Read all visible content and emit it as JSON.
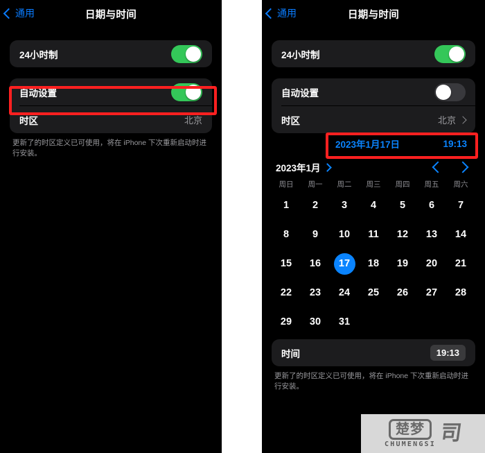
{
  "colors": {
    "background": "#000000",
    "card": "#1c1c1e",
    "accent_blue": "#0a84ff",
    "toggle_on_green": "#34c759",
    "toggle_off_gray": "#39393d",
    "annotation_red": "#ff2020",
    "secondary_text": "#8e8e93"
  },
  "left_panel": {
    "nav": {
      "back_label": "通用",
      "title": "日期与时间"
    },
    "rows": {
      "hour24_label": "24小时制",
      "hour24_state": "on",
      "auto_label": "自动设置",
      "auto_state": "on",
      "timezone_label": "时区",
      "timezone_value": "北京"
    },
    "footnote": "更新了的时区定义已可使用，将在 iPhone 下次重新启动时进行安装。"
  },
  "right_panel": {
    "nav": {
      "back_label": "通用",
      "title": "日期与时间"
    },
    "rows": {
      "hour24_label": "24小时制",
      "hour24_state": "on",
      "auto_label": "自动设置",
      "auto_state": "off",
      "timezone_label": "时区",
      "timezone_value": "北京"
    },
    "datetime_field": {
      "date_value": "2023年1月17日",
      "time_value": "19:13"
    },
    "calendar": {
      "month_label": "2023年1月",
      "prev_arrow": "chevron-left-icon",
      "next_arrow": "chevron-right-icon",
      "weekdays": [
        "周日",
        "周一",
        "周二",
        "周三",
        "周四",
        "周五",
        "周六"
      ],
      "weeks": [
        [
          "1",
          "2",
          "3",
          "4",
          "5",
          "6",
          "7"
        ],
        [
          "8",
          "9",
          "10",
          "11",
          "12",
          "13",
          "14"
        ],
        [
          "15",
          "16",
          "17",
          "18",
          "19",
          "20",
          "21"
        ],
        [
          "22",
          "23",
          "24",
          "25",
          "26",
          "27",
          "28"
        ],
        [
          "29",
          "30",
          "31",
          "",
          "",
          "",
          ""
        ]
      ],
      "selected_day": "17"
    },
    "time_row": {
      "label": "时间",
      "value": "19:13"
    },
    "footnote": "更新了的时区定义已可使用，将在 iPhone 下次重新启动时进行安装。"
  },
  "watermark": {
    "cn_text": "楚梦",
    "en_text": "CHUMENGSI",
    "mark": "司"
  }
}
